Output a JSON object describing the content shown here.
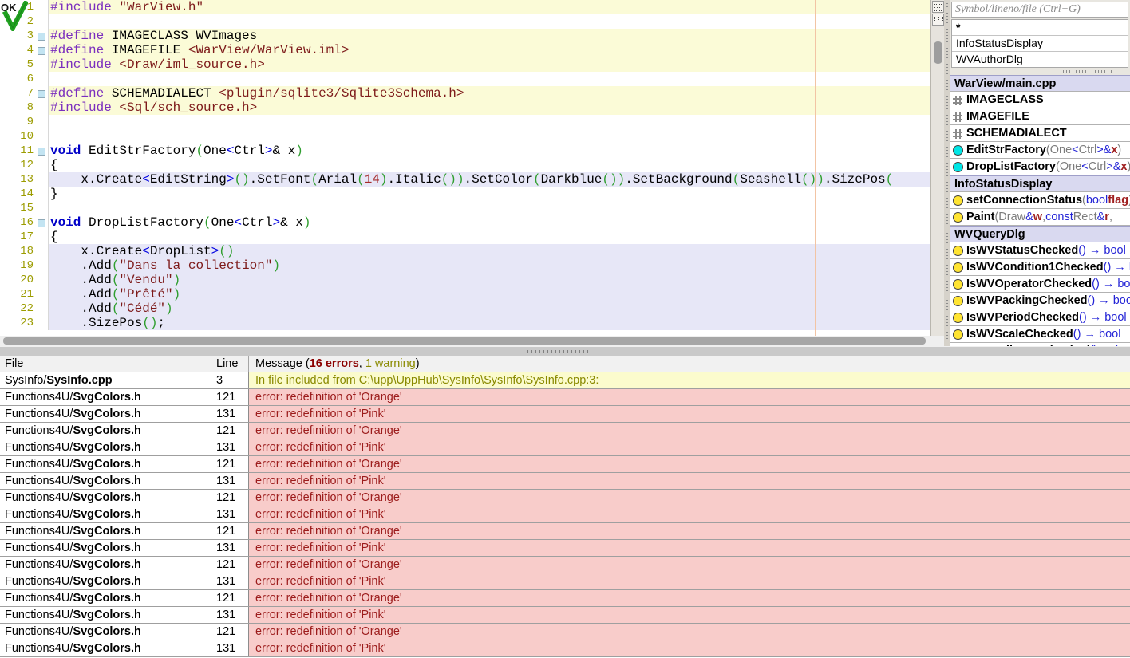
{
  "editor": {
    "status_ok": "OK",
    "lines": [
      {
        "num": 1,
        "marker": false,
        "bg": "c",
        "segs": [
          [
            "pp",
            "#include"
          ],
          [
            "plain",
            " "
          ],
          [
            "str",
            "\"WarView.h\""
          ]
        ]
      },
      {
        "num": 2,
        "marker": false,
        "bg": "w",
        "segs": []
      },
      {
        "num": 3,
        "marker": true,
        "bg": "c",
        "segs": [
          [
            "pp",
            "#define"
          ],
          [
            "plain",
            " IMAGECLASS WVImages"
          ]
        ]
      },
      {
        "num": 4,
        "marker": true,
        "bg": "c",
        "segs": [
          [
            "pp",
            "#define"
          ],
          [
            "plain",
            " IMAGEFILE "
          ],
          [
            "str",
            "<WarView/WarView.iml>"
          ]
        ]
      },
      {
        "num": 5,
        "marker": false,
        "bg": "c",
        "segs": [
          [
            "pp",
            "#include"
          ],
          [
            "plain",
            " "
          ],
          [
            "str",
            "<Draw/iml_source.h>"
          ]
        ]
      },
      {
        "num": 6,
        "marker": false,
        "bg": "w",
        "segs": []
      },
      {
        "num": 7,
        "marker": true,
        "bg": "c",
        "segs": [
          [
            "pp",
            "#define"
          ],
          [
            "plain",
            " SCHEMADIALECT "
          ],
          [
            "str",
            "<plugin/sqlite3/Sqlite3Schema.h>"
          ]
        ]
      },
      {
        "num": 8,
        "marker": false,
        "bg": "c",
        "segs": [
          [
            "pp",
            "#include"
          ],
          [
            "plain",
            " "
          ],
          [
            "str",
            "<Sql/sch_source.h>"
          ]
        ]
      },
      {
        "num": 9,
        "marker": false,
        "bg": "w",
        "segs": []
      },
      {
        "num": 10,
        "marker": false,
        "bg": "w",
        "segs": []
      },
      {
        "num": 11,
        "marker": true,
        "bg": "w",
        "segs": [
          [
            "kw",
            "void"
          ],
          [
            "plain",
            " EditStrFactory"
          ],
          [
            "paren",
            "("
          ],
          [
            "plain",
            "One"
          ],
          [
            "angle",
            "<"
          ],
          [
            "plain",
            "Ctrl"
          ],
          [
            "angle",
            ">"
          ],
          [
            "plain",
            "& x"
          ],
          [
            "paren",
            ")"
          ]
        ]
      },
      {
        "num": 12,
        "marker": false,
        "bg": "w",
        "segs": [
          [
            "plain",
            "{"
          ]
        ]
      },
      {
        "num": 13,
        "marker": false,
        "bg": "l",
        "segs": [
          [
            "plain",
            "    x.Create"
          ],
          [
            "angle",
            "<"
          ],
          [
            "plain",
            "EditString"
          ],
          [
            "angle",
            ">"
          ],
          [
            "paren",
            "()"
          ],
          [
            "plain",
            ".SetFont"
          ],
          [
            "paren",
            "("
          ],
          [
            "plain",
            "Arial"
          ],
          [
            "paren",
            "("
          ],
          [
            "num",
            "14"
          ],
          [
            "paren",
            ")"
          ],
          [
            "plain",
            ".Italic"
          ],
          [
            "paren",
            "()"
          ],
          [
            "paren",
            ")"
          ],
          [
            "plain",
            ".SetColor"
          ],
          [
            "paren",
            "("
          ],
          [
            "plain",
            "Darkblue"
          ],
          [
            "paren",
            "()"
          ],
          [
            "paren",
            ")"
          ],
          [
            "plain",
            ".SetBackground"
          ],
          [
            "paren",
            "("
          ],
          [
            "plain",
            "Seashell"
          ],
          [
            "paren",
            "()"
          ],
          [
            "paren",
            ")"
          ],
          [
            "plain",
            ".SizePos"
          ],
          [
            "paren",
            "("
          ]
        ]
      },
      {
        "num": 14,
        "marker": false,
        "bg": "w",
        "segs": [
          [
            "plain",
            "}"
          ]
        ]
      },
      {
        "num": 15,
        "marker": false,
        "bg": "w",
        "segs": []
      },
      {
        "num": 16,
        "marker": true,
        "bg": "w",
        "segs": [
          [
            "kw",
            "void"
          ],
          [
            "plain",
            " DropListFactory"
          ],
          [
            "paren",
            "("
          ],
          [
            "plain",
            "One"
          ],
          [
            "angle",
            "<"
          ],
          [
            "plain",
            "Ctrl"
          ],
          [
            "angle",
            ">"
          ],
          [
            "plain",
            "& x"
          ],
          [
            "paren",
            ")"
          ]
        ]
      },
      {
        "num": 17,
        "marker": false,
        "bg": "w",
        "segs": [
          [
            "plain",
            "{"
          ]
        ]
      },
      {
        "num": 18,
        "marker": false,
        "bg": "l",
        "segs": [
          [
            "plain",
            "    x.Create"
          ],
          [
            "angle",
            "<"
          ],
          [
            "plain",
            "DropList"
          ],
          [
            "angle",
            ">"
          ],
          [
            "paren",
            "()"
          ]
        ]
      },
      {
        "num": 19,
        "marker": false,
        "bg": "l",
        "segs": [
          [
            "plain",
            "    .Add"
          ],
          [
            "paren",
            "("
          ],
          [
            "str",
            "\"Dans la collection\""
          ],
          [
            "paren",
            ")"
          ]
        ]
      },
      {
        "num": 20,
        "marker": false,
        "bg": "l",
        "segs": [
          [
            "plain",
            "    .Add"
          ],
          [
            "paren",
            "("
          ],
          [
            "str",
            "\"Vendu\""
          ],
          [
            "paren",
            ")"
          ]
        ]
      },
      {
        "num": 21,
        "marker": false,
        "bg": "l",
        "segs": [
          [
            "plain",
            "    .Add"
          ],
          [
            "paren",
            "("
          ],
          [
            "str",
            "\"Prêté\""
          ],
          [
            "paren",
            ")"
          ]
        ]
      },
      {
        "num": 22,
        "marker": false,
        "bg": "l",
        "segs": [
          [
            "plain",
            "    .Add"
          ],
          [
            "paren",
            "("
          ],
          [
            "str",
            "\"Cédé\""
          ],
          [
            "paren",
            ")"
          ]
        ]
      },
      {
        "num": 23,
        "marker": false,
        "bg": "l",
        "segs": [
          [
            "plain",
            "    .SizePos"
          ],
          [
            "paren",
            "()"
          ],
          [
            "plain",
            ";"
          ]
        ]
      }
    ]
  },
  "right_panel": {
    "search_placeholder": "Symbol/lineno/file (Ctrl+G)",
    "top_list": [
      "*",
      "InfoStatusDisplay",
      "WVAuthorDlg"
    ],
    "symbols": [
      {
        "type": "hdr",
        "icon": null,
        "segs": [
          [
            "plain",
            "WarView/"
          ],
          [
            "bold",
            "main.cpp"
          ]
        ]
      },
      {
        "type": "item",
        "icon": "hash",
        "segs": [
          [
            "bold",
            "IMAGECLASS"
          ]
        ]
      },
      {
        "type": "item",
        "icon": "hash",
        "segs": [
          [
            "bold",
            "IMAGEFILE"
          ]
        ]
      },
      {
        "type": "item",
        "icon": "hash",
        "segs": [
          [
            "bold",
            "SCHEMADIALECT"
          ]
        ]
      },
      {
        "type": "item",
        "icon": "cyan",
        "segs": [
          [
            "bold",
            "EditStrFactory"
          ],
          [
            "gray",
            "(One"
          ],
          [
            "blue",
            "<"
          ],
          [
            "gray",
            "Ctrl"
          ],
          [
            "blue",
            ">"
          ],
          [
            "blue",
            "& "
          ],
          [
            "redbold",
            "x"
          ],
          [
            "gray",
            ")"
          ]
        ]
      },
      {
        "type": "item",
        "icon": "cyan",
        "segs": [
          [
            "bold",
            "DropListFactory"
          ],
          [
            "gray",
            "(One"
          ],
          [
            "blue",
            "<"
          ],
          [
            "gray",
            "Ctrl"
          ],
          [
            "blue",
            ">"
          ],
          [
            "blue",
            "& "
          ],
          [
            "redbold",
            "x"
          ],
          [
            "gray",
            ")"
          ]
        ]
      },
      {
        "type": "hdr",
        "icon": null,
        "segs": [
          [
            "bold",
            "InfoStatusDisplay"
          ]
        ]
      },
      {
        "type": "item",
        "icon": "yellow",
        "segs": [
          [
            "bold",
            "setConnectionStatus"
          ],
          [
            "gray",
            "("
          ],
          [
            "blue",
            "bool"
          ],
          [
            "plain",
            " "
          ],
          [
            "redbold",
            "flag"
          ],
          [
            "gray",
            ")"
          ]
        ]
      },
      {
        "type": "item",
        "icon": "yellow",
        "segs": [
          [
            "bold",
            "Paint"
          ],
          [
            "gray",
            "(Draw"
          ],
          [
            "blue",
            "&"
          ],
          [
            "plain",
            " "
          ],
          [
            "redbold",
            "w"
          ],
          [
            "gray",
            ", "
          ],
          [
            "blue",
            "const"
          ],
          [
            "gray",
            " Rect"
          ],
          [
            "blue",
            "&"
          ],
          [
            "plain",
            " "
          ],
          [
            "redbold",
            "r"
          ],
          [
            "gray",
            ","
          ]
        ]
      },
      {
        "type": "hdr",
        "icon": null,
        "segs": [
          [
            "bold",
            "WVQueryDlg"
          ]
        ]
      },
      {
        "type": "item",
        "icon": "yellow",
        "segs": [
          [
            "bold",
            "IsWVStatusChecked"
          ],
          [
            "blue",
            "() → bool"
          ]
        ]
      },
      {
        "type": "item",
        "icon": "yellow",
        "segs": [
          [
            "bold",
            "IsWVCondition1Checked"
          ],
          [
            "blue",
            "() → bool"
          ]
        ]
      },
      {
        "type": "item",
        "icon": "yellow",
        "segs": [
          [
            "bold",
            "IsWVOperatorChecked"
          ],
          [
            "blue",
            "() → bool"
          ]
        ]
      },
      {
        "type": "item",
        "icon": "yellow",
        "segs": [
          [
            "bold",
            "IsWVPackingChecked"
          ],
          [
            "blue",
            "() → bool"
          ]
        ]
      },
      {
        "type": "item",
        "icon": "yellow",
        "segs": [
          [
            "bold",
            "IsWVPeriodChecked"
          ],
          [
            "blue",
            "() → bool"
          ]
        ]
      },
      {
        "type": "item",
        "icon": "yellow",
        "segs": [
          [
            "bold",
            "IsWVScaleChecked"
          ],
          [
            "blue",
            "() → bool"
          ]
        ]
      },
      {
        "type": "item",
        "icon": "yellow",
        "segs": [
          [
            "bold",
            "IsWVEditDateChecked"
          ],
          [
            "blue",
            "() → bool"
          ]
        ]
      }
    ]
  },
  "error_panel": {
    "header": {
      "file": "File",
      "line": "Line",
      "message_prefix": "Message (",
      "errors": "16 errors",
      "sep": ", ",
      "warning": "1 warning",
      "suffix": ")"
    },
    "rows": [
      {
        "file_prefix": "SysInfo/",
        "file_bold": "SysInfo.cpp",
        "line": "3",
        "kind": "warning",
        "message": "In file included from C:\\upp\\UppHub\\SysInfo\\SysInfo\\SysInfo.cpp:3:"
      },
      {
        "file_prefix": "Functions4U/",
        "file_bold": "SvgColors.h",
        "line": "121",
        "kind": "error",
        "message": "error: redefinition of 'Orange'"
      },
      {
        "file_prefix": "Functions4U/",
        "file_bold": "SvgColors.h",
        "line": "131",
        "kind": "error",
        "message": "error: redefinition of 'Pink'"
      },
      {
        "file_prefix": "Functions4U/",
        "file_bold": "SvgColors.h",
        "line": "121",
        "kind": "error",
        "message": "error: redefinition of 'Orange'"
      },
      {
        "file_prefix": "Functions4U/",
        "file_bold": "SvgColors.h",
        "line": "131",
        "kind": "error",
        "message": "error: redefinition of 'Pink'"
      },
      {
        "file_prefix": "Functions4U/",
        "file_bold": "SvgColors.h",
        "line": "121",
        "kind": "error",
        "message": "error: redefinition of 'Orange'"
      },
      {
        "file_prefix": "Functions4U/",
        "file_bold": "SvgColors.h",
        "line": "131",
        "kind": "error",
        "message": "error: redefinition of 'Pink'"
      },
      {
        "file_prefix": "Functions4U/",
        "file_bold": "SvgColors.h",
        "line": "121",
        "kind": "error",
        "message": "error: redefinition of 'Orange'"
      },
      {
        "file_prefix": "Functions4U/",
        "file_bold": "SvgColors.h",
        "line": "131",
        "kind": "error",
        "message": "error: redefinition of 'Pink'"
      },
      {
        "file_prefix": "Functions4U/",
        "file_bold": "SvgColors.h",
        "line": "121",
        "kind": "error",
        "message": "error: redefinition of 'Orange'"
      },
      {
        "file_prefix": "Functions4U/",
        "file_bold": "SvgColors.h",
        "line": "131",
        "kind": "error",
        "message": "error: redefinition of 'Pink'"
      },
      {
        "file_prefix": "Functions4U/",
        "file_bold": "SvgColors.h",
        "line": "121",
        "kind": "error",
        "message": "error: redefinition of 'Orange'"
      },
      {
        "file_prefix": "Functions4U/",
        "file_bold": "SvgColors.h",
        "line": "131",
        "kind": "error",
        "message": "error: redefinition of 'Pink'"
      },
      {
        "file_prefix": "Functions4U/",
        "file_bold": "SvgColors.h",
        "line": "121",
        "kind": "error",
        "message": "error: redefinition of 'Orange'"
      },
      {
        "file_prefix": "Functions4U/",
        "file_bold": "SvgColors.h",
        "line": "131",
        "kind": "error",
        "message": "error: redefinition of 'Pink'"
      },
      {
        "file_prefix": "Functions4U/",
        "file_bold": "SvgColors.h",
        "line": "121",
        "kind": "error",
        "message": "error: redefinition of 'Orange'"
      },
      {
        "file_prefix": "Functions4U/",
        "file_bold": "SvgColors.h",
        "line": "131",
        "kind": "error",
        "message": "error: redefinition of 'Pink'"
      }
    ]
  },
  "colors": {
    "line_cream": "#fbfbd7",
    "line_lavender": "#e7e7f7",
    "selection_header": "#d9d9f0",
    "icon_cyan": "#00e6e6",
    "icon_yellow": "#ffe432",
    "check_green": "#21a121",
    "guide": "#f2c4a4",
    "error_bg": "#f8ccca",
    "error_text": "#9c1c1c",
    "warning_bg": "#fbfbcd",
    "warning_text": "#8a8a00"
  }
}
